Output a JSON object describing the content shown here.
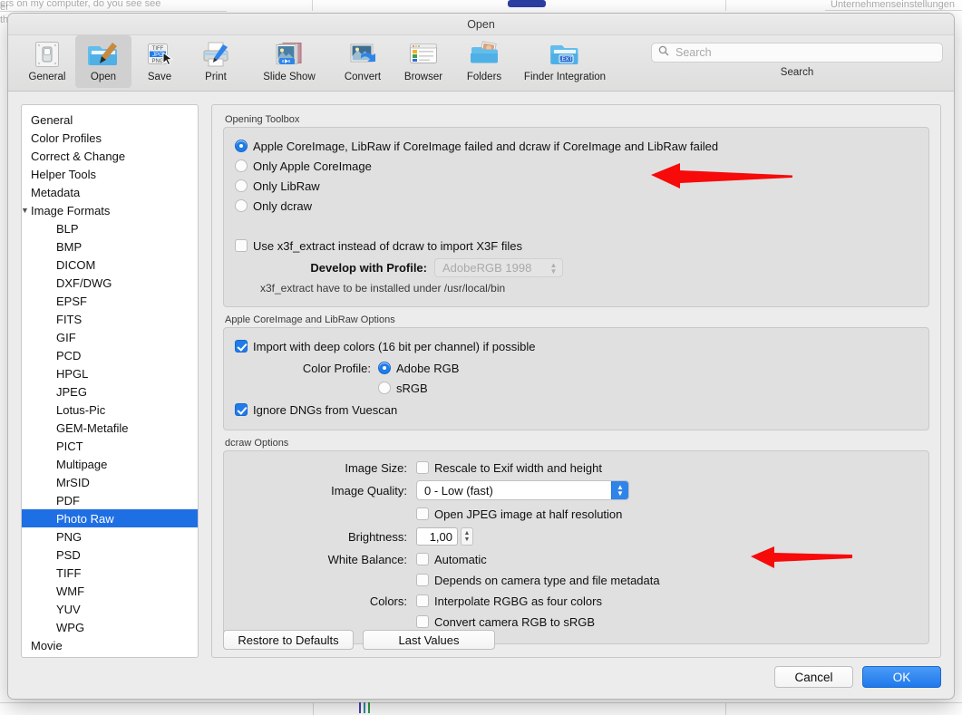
{
  "background": {
    "top_text_left": "ers on my computer, do you see see",
    "top_text_edge1": "er",
    "top_text_edge2": "th",
    "top_text_right": "Unternehmenseinstellungen"
  },
  "window": {
    "title": "Open"
  },
  "toolbar": {
    "items": [
      {
        "label": "General",
        "icon": "switch-panel-icon",
        "selected": false
      },
      {
        "label": "Open",
        "icon": "folder-brush-icon",
        "selected": true
      },
      {
        "label": "Save",
        "icon": "format-list-icon",
        "selected": false
      },
      {
        "label": "Print",
        "icon": "printer-icon",
        "selected": false
      },
      {
        "label": "Slide Show",
        "icon": "slideshow-icon",
        "selected": false
      },
      {
        "label": "Convert",
        "icon": "convert-arrow-icon",
        "selected": false
      },
      {
        "label": "Browser",
        "icon": "browser-window-icon",
        "selected": false
      },
      {
        "label": "Folders",
        "icon": "folder-photos-icon",
        "selected": false
      },
      {
        "label": "Finder Integration",
        "icon": "folder-ext-icon",
        "selected": false
      }
    ],
    "search": {
      "placeholder": "Search",
      "value": "",
      "icon": "search-icon",
      "caption": "Search"
    }
  },
  "sidebar": {
    "items": [
      {
        "label": "General",
        "indent": 0,
        "selected": false,
        "disclosure": ""
      },
      {
        "label": "Color Profiles",
        "indent": 0,
        "selected": false,
        "disclosure": ""
      },
      {
        "label": "Correct & Change",
        "indent": 0,
        "selected": false,
        "disclosure": ""
      },
      {
        "label": "Helper Tools",
        "indent": 0,
        "selected": false,
        "disclosure": ""
      },
      {
        "label": "Metadata",
        "indent": 0,
        "selected": false,
        "disclosure": ""
      },
      {
        "label": "Image Formats",
        "indent": 0,
        "selected": false,
        "disclosure": "▼"
      },
      {
        "label": "BLP",
        "indent": 1,
        "selected": false,
        "disclosure": ""
      },
      {
        "label": "BMP",
        "indent": 1,
        "selected": false,
        "disclosure": ""
      },
      {
        "label": "DICOM",
        "indent": 1,
        "selected": false,
        "disclosure": ""
      },
      {
        "label": "DXF/DWG",
        "indent": 1,
        "selected": false,
        "disclosure": ""
      },
      {
        "label": "EPSF",
        "indent": 1,
        "selected": false,
        "disclosure": ""
      },
      {
        "label": "FITS",
        "indent": 1,
        "selected": false,
        "disclosure": ""
      },
      {
        "label": "GIF",
        "indent": 1,
        "selected": false,
        "disclosure": ""
      },
      {
        "label": "PCD",
        "indent": 1,
        "selected": false,
        "disclosure": ""
      },
      {
        "label": "HPGL",
        "indent": 1,
        "selected": false,
        "disclosure": ""
      },
      {
        "label": "JPEG",
        "indent": 1,
        "selected": false,
        "disclosure": ""
      },
      {
        "label": "Lotus-Pic",
        "indent": 1,
        "selected": false,
        "disclosure": ""
      },
      {
        "label": "GEM-Metafile",
        "indent": 1,
        "selected": false,
        "disclosure": ""
      },
      {
        "label": "PICT",
        "indent": 1,
        "selected": false,
        "disclosure": ""
      },
      {
        "label": "Multipage",
        "indent": 1,
        "selected": false,
        "disclosure": ""
      },
      {
        "label": "MrSID",
        "indent": 1,
        "selected": false,
        "disclosure": ""
      },
      {
        "label": "PDF",
        "indent": 1,
        "selected": false,
        "disclosure": ""
      },
      {
        "label": "Photo Raw",
        "indent": 1,
        "selected": true,
        "disclosure": ""
      },
      {
        "label": "PNG",
        "indent": 1,
        "selected": false,
        "disclosure": ""
      },
      {
        "label": "PSD",
        "indent": 1,
        "selected": false,
        "disclosure": ""
      },
      {
        "label": "TIFF",
        "indent": 1,
        "selected": false,
        "disclosure": ""
      },
      {
        "label": "WMF",
        "indent": 1,
        "selected": false,
        "disclosure": ""
      },
      {
        "label": "YUV",
        "indent": 1,
        "selected": false,
        "disclosure": ""
      },
      {
        "label": "WPG",
        "indent": 1,
        "selected": false,
        "disclosure": ""
      },
      {
        "label": "Movie",
        "indent": 0,
        "selected": false,
        "disclosure": ""
      }
    ]
  },
  "opening_toolbox": {
    "title": "Opening Toolbox",
    "radios": [
      {
        "label": "Apple CoreImage, LibRaw if CoreImage failed and dcraw if CoreImage and LibRaw failed",
        "checked": true
      },
      {
        "label": "Only Apple CoreImage",
        "checked": false
      },
      {
        "label": "Only LibRaw",
        "checked": false
      },
      {
        "label": "Only dcraw",
        "checked": false
      }
    ],
    "x3f_checkbox": {
      "label": "Use x3f_extract instead of dcraw to import X3F files",
      "checked": false
    },
    "profile_label": "Develop with Profile:",
    "profile_value": "AdobeRGB 1998",
    "profile_disabled": true,
    "hint": "x3f_extract have to be installed under /usr/local/bin"
  },
  "coreimage_options": {
    "title": "Apple CoreImage and LibRaw Options",
    "deep_colors": {
      "label": "Import with deep colors (16 bit per channel) if possible",
      "checked": true
    },
    "color_profile_label": "Color Profile:",
    "color_profile_radios": [
      {
        "label": "Adobe RGB",
        "checked": true
      },
      {
        "label": "sRGB",
        "checked": false
      }
    ],
    "ignore_dngs": {
      "label": "Ignore DNGs from Vuescan",
      "checked": true
    }
  },
  "dcraw_options": {
    "title": "dcraw Options",
    "image_size_label": "Image Size:",
    "rescale": {
      "label": "Rescale to Exif width and height",
      "checked": false
    },
    "image_quality_label": "Image Quality:",
    "image_quality_value": "0 - Low (fast)",
    "half_res": {
      "label": "Open JPEG image at half resolution",
      "checked": false
    },
    "brightness_label": "Brightness:",
    "brightness_value": "1,00",
    "white_balance_label": "White Balance:",
    "wb_automatic": {
      "label": "Automatic",
      "checked": false
    },
    "wb_depends": {
      "label": "Depends on camera type and file metadata",
      "checked": false
    },
    "colors_label": "Colors:",
    "interpolate": {
      "label": "Interpolate RGBG as four colors",
      "checked": false
    },
    "convert_srgb": {
      "label": "Convert camera RGB to sRGB",
      "checked": false
    }
  },
  "panel_buttons": {
    "restore": "Restore to Defaults",
    "last_values": "Last Values"
  },
  "footer": {
    "cancel": "Cancel",
    "ok": "OK"
  },
  "annotations": {
    "arrow_color": "#f60a0a",
    "arrow_1_name": "red-arrow-opening-toolbox",
    "arrow_2_name": "red-arrow-white-balance"
  },
  "colors": {
    "accent_blue": "#1f7ce8",
    "selection_blue": "#1f6fe4",
    "window_bg": "#ececec",
    "group_bg": "#e0e0e0"
  }
}
